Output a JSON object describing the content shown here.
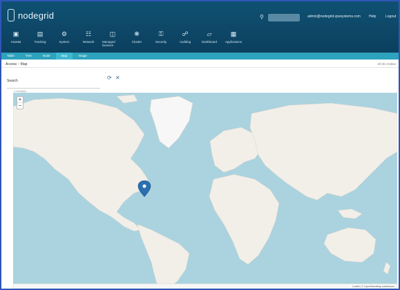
{
  "app": {
    "logo_text": "nodegrid"
  },
  "header": {
    "search_icon": "search-icon",
    "user": "admin@nodegrid.zpesystems.com",
    "help": "Help",
    "logout": "Logout"
  },
  "nav": [
    {
      "label": "Access",
      "icon": "monitor-icon",
      "active": true
    },
    {
      "label": "Tracking",
      "icon": "chart-icon"
    },
    {
      "label": "System",
      "icon": "gear-icon"
    },
    {
      "label": "Network",
      "icon": "network-icon"
    },
    {
      "label": "Managed Devices",
      "icon": "devices-icon"
    },
    {
      "label": "Cluster",
      "icon": "cluster-icon"
    },
    {
      "label": "Security",
      "icon": "lock-icon"
    },
    {
      "label": "Auditing",
      "icon": "shield-icon"
    },
    {
      "label": "Dashboard",
      "icon": "dashboard-icon"
    },
    {
      "label": "Applications",
      "icon": "apps-icon"
    }
  ],
  "subnav": [
    {
      "label": "Table"
    },
    {
      "label": "Tree"
    },
    {
      "label": "Node"
    },
    {
      "label": "Map",
      "active": true
    },
    {
      "label": "Image"
    }
  ],
  "page": {
    "breadcrumb": "Access :: Map",
    "status_right": "All 0/1 Online",
    "search_label": "Search",
    "search_placeholder": "",
    "results_note": "1 result(s)"
  },
  "map": {
    "zoom_in": "+",
    "zoom_out": "−",
    "attribution": "Leaflet | © OpenStreetMap contributors",
    "colors": {
      "ocean": "#aad3df",
      "land": "#f2efe9",
      "ice": "#f7f7f7",
      "marker": "#2a6fb0"
    }
  }
}
